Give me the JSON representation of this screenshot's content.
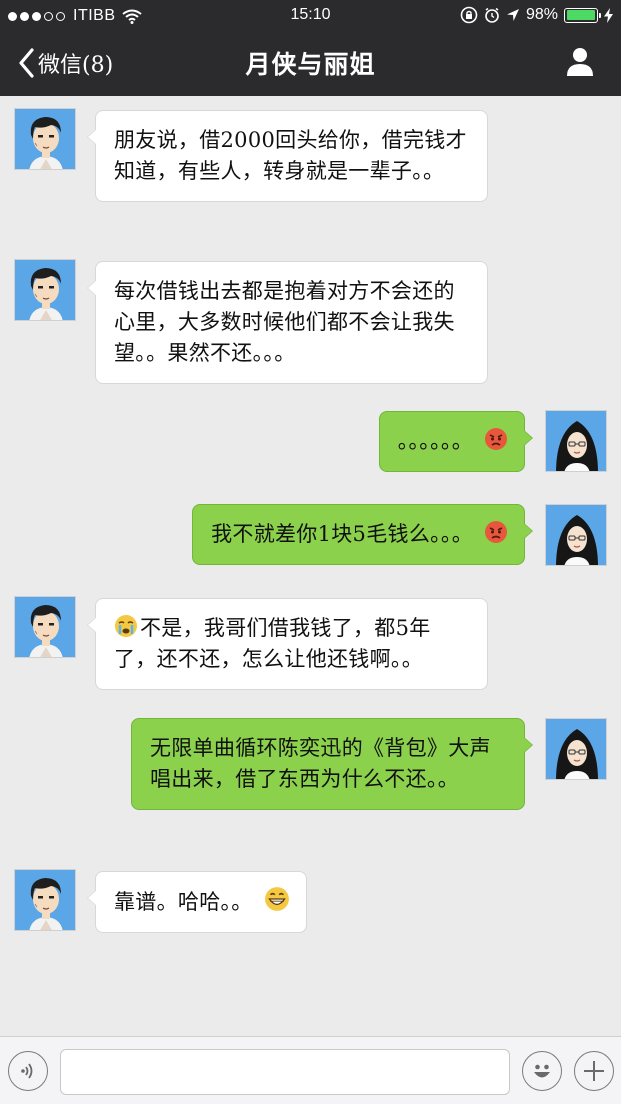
{
  "status_bar": {
    "carrier": "ITIBB",
    "time": "15:10",
    "battery": "98%",
    "battery_level": 0.98,
    "icons": [
      "signal-dots-icon",
      "wifi-icon",
      "rotation-lock-icon",
      "alarm-icon",
      "location-arrow-icon",
      "battery-icon",
      "charging-bolt-icon"
    ]
  },
  "nav": {
    "back_label": "微信(8)",
    "title": "月侠与丽姐",
    "icons": [
      "chevron-left-icon",
      "person-icon"
    ]
  },
  "messages": [
    {
      "side": "left",
      "text": "朋友说，借2000回头给你，借完钱才知道，有些人，转身就是一辈子。。"
    },
    {
      "side": "left",
      "text": "每次借钱出去都是抱着对方不会还的心里，大多数时候他们都不会让我失望。。果然不还。。。"
    },
    {
      "side": "right",
      "text": "。。。。。。",
      "emoji": "angry-face-emoji"
    },
    {
      "side": "right",
      "text": "我不就差你1块5毛钱么。。。",
      "emoji": "angry-face-emoji"
    },
    {
      "side": "left",
      "text": "不是，我哥们借我钱了，都5年了，还不还，怎么让他还钱啊。。",
      "emoji": "crying-face-emoji"
    },
    {
      "side": "right",
      "text": "无限单曲循环陈奕迅的《背包》大声唱出来，借了东西为什么不还。。"
    },
    {
      "side": "left",
      "text": "靠谱。哈哈。。",
      "emoji": "grinning-face-emoji"
    }
  ],
  "input_bar": {
    "value": "",
    "icons": [
      "voice-icon",
      "emoji-icon",
      "plus-icon"
    ]
  },
  "colors": {
    "nav_bg": "#2b2b2d",
    "chat_bg": "#ebebeb",
    "outgoing_bubble": "#8bd14c",
    "incoming_bubble": "#ffffff",
    "battery_fill": "#4cd964"
  }
}
